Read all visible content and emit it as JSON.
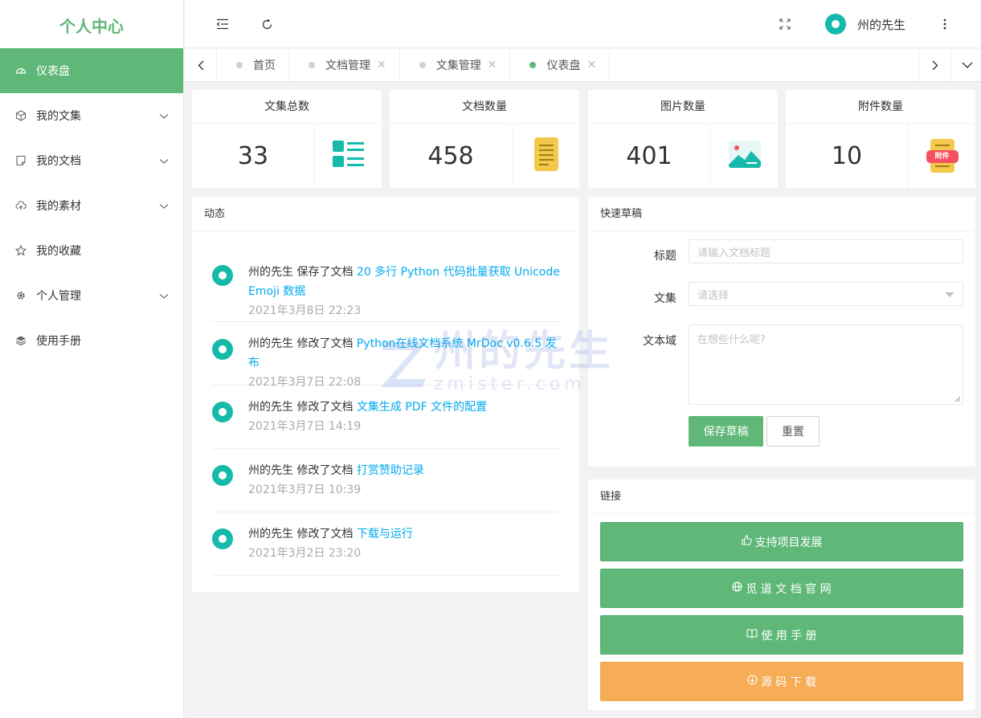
{
  "sidebar": {
    "logo": "个人中心",
    "items": [
      {
        "label": "仪表盘",
        "icon": "dashboard-icon"
      },
      {
        "label": "我的文集",
        "icon": "cube-icon"
      },
      {
        "label": "我的文档",
        "icon": "note-icon"
      },
      {
        "label": "我的素材",
        "icon": "cloud-upload-icon"
      },
      {
        "label": "我的收藏",
        "icon": "star-icon"
      },
      {
        "label": "个人管理",
        "icon": "gear-icon"
      },
      {
        "label": "使用手册",
        "icon": "layers-icon"
      }
    ]
  },
  "header": {
    "user_name": "州的先生"
  },
  "tabs": [
    {
      "label": "首页"
    },
    {
      "label": "文档管理"
    },
    {
      "label": "文集管理"
    },
    {
      "label": "仪表盘"
    }
  ],
  "stats": [
    {
      "title": "文集总数",
      "value": "33",
      "icon": "list-icon"
    },
    {
      "title": "文档数量",
      "value": "458",
      "icon": "document-icon"
    },
    {
      "title": "图片数量",
      "value": "401",
      "icon": "image-icon"
    },
    {
      "title": "附件数量",
      "value": "10",
      "icon": "attachment-icon",
      "badge": "附件"
    }
  ],
  "activity": {
    "title": "动态",
    "items": [
      {
        "user": "州的先生",
        "action": "保存了文档",
        "link": "20 多行 Python 代码批量获取 Unicode Emoji 数据",
        "time": "2021年3月8日 22:23"
      },
      {
        "user": "州的先生",
        "action": "修改了文档",
        "link": "Python在线文档系统 MrDoc v0.6.5 发布",
        "time": "2021年3月7日 22:08"
      },
      {
        "user": "州的先生",
        "action": "修改了文档",
        "link": "文集生成 PDF 文件的配置",
        "time": "2021年3月7日 14:19"
      },
      {
        "user": "州的先生",
        "action": "修改了文档",
        "link": "打赏赞助记录",
        "time": "2021年3月7日 10:39"
      },
      {
        "user": "州的先生",
        "action": "修改了文档",
        "link": "下载与运行",
        "time": "2021年3月2日 23:20"
      }
    ]
  },
  "draft": {
    "title": "快速草稿",
    "title_label": "标题",
    "title_placeholder": "请输入文档标题",
    "collection_label": "文集",
    "collection_placeholder": "请选择",
    "text_label": "文本域",
    "text_placeholder": "在想些什么呢?",
    "save": "保存草稿",
    "reset": "重置"
  },
  "links": {
    "title": "链接",
    "items": [
      {
        "label": "支持项目发展",
        "icon": "thumbs-up-icon"
      },
      {
        "label": "觅 道 文 档 官 网",
        "icon": "globe-icon"
      },
      {
        "label": "使 用 手 册",
        "icon": "book-icon"
      },
      {
        "label": "源 码 下 载",
        "icon": "download-icon"
      }
    ]
  },
  "watermark": {
    "main": "州的先生",
    "sub": "zmister.com"
  },
  "colors": {
    "brand": "#5fb878",
    "teal": "#16baaa",
    "link": "#01aaed",
    "orange": "#f6ad55"
  }
}
